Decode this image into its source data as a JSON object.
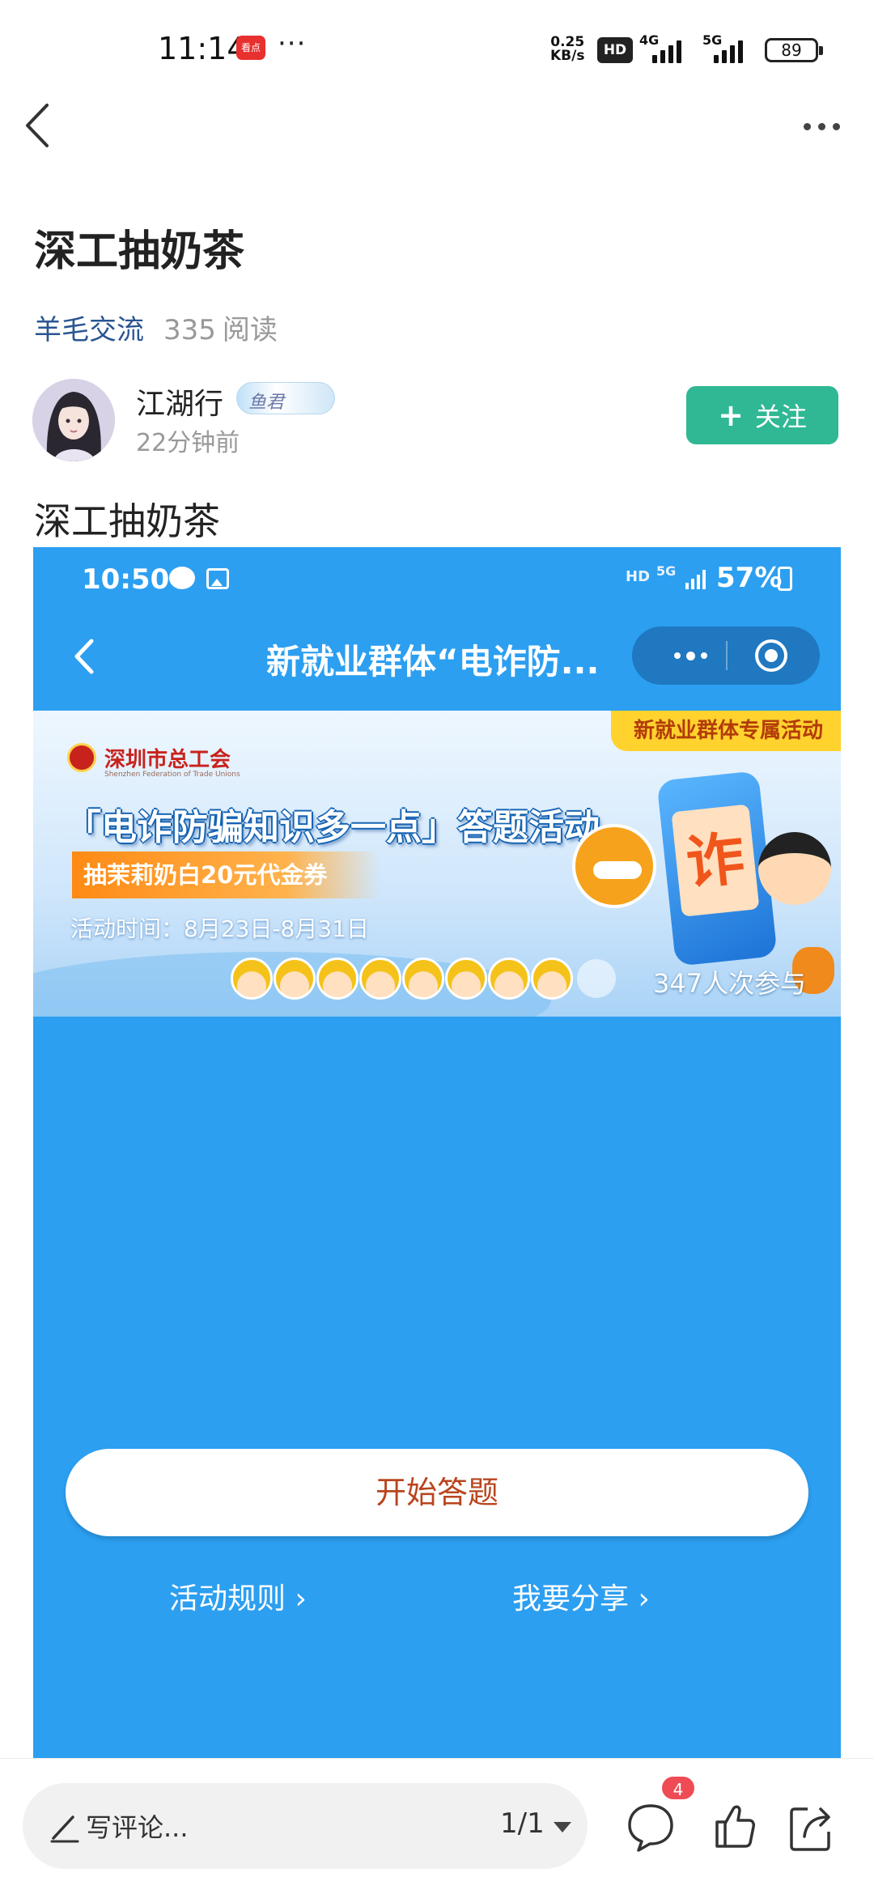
{
  "status_bar": {
    "time": "11:14",
    "app_badge": "看点",
    "overflow": "···",
    "net_speed_value": "0.25",
    "net_speed_unit": "KB/s",
    "hd_label": "HD",
    "network_1": "4G",
    "network_2": "5G",
    "battery": "89",
    "icons": [
      "signal-icon",
      "battery-icon"
    ]
  },
  "nav": {
    "back_icon": "chevron-left-icon",
    "more_icon": "more-dots-icon"
  },
  "article": {
    "title": "深工抽奶茶",
    "category": "羊毛交流",
    "read_count": "335",
    "read_label": "阅读",
    "author": {
      "name": "江湖行",
      "badge_text": "鱼君",
      "post_time": "22分钟前"
    },
    "follow_button": {
      "icon": "+",
      "label": "关注"
    },
    "body_text": "深工抽奶茶"
  },
  "embedded_screenshot": {
    "status": {
      "time": "10:50",
      "hd": "HD",
      "network": "5G",
      "battery": "57%"
    },
    "page_title": "新就业群体“电诈防...",
    "banner": {
      "tag": "新就业群体专属活动",
      "organization": "深圳市总工会",
      "organization_en": "Shenzhen Federation of Trade Unions",
      "headline": "「电诈防骗知识多一点」答题活动",
      "coupon": "抽茉莉奶白20元代金券",
      "activity_time": "活动时间：8月23日-8月31日",
      "participants": "347人次参与",
      "sign_text": "诈"
    },
    "start_button": "开始答题",
    "rules_link": "活动规则 ›",
    "share_link": "我要分享 ›",
    "background_color": "#2c9ff1"
  },
  "bottom_bar": {
    "comment_placeholder": "写评论...",
    "page_indicator": "1/1",
    "comment_badge": "4",
    "icons": [
      "pencil-icon",
      "comment-icon",
      "like-icon",
      "share-icon"
    ]
  },
  "colors": {
    "accent_green": "#2fb893",
    "category_blue": "#2a5592",
    "badge_red": "#ef4b55"
  }
}
